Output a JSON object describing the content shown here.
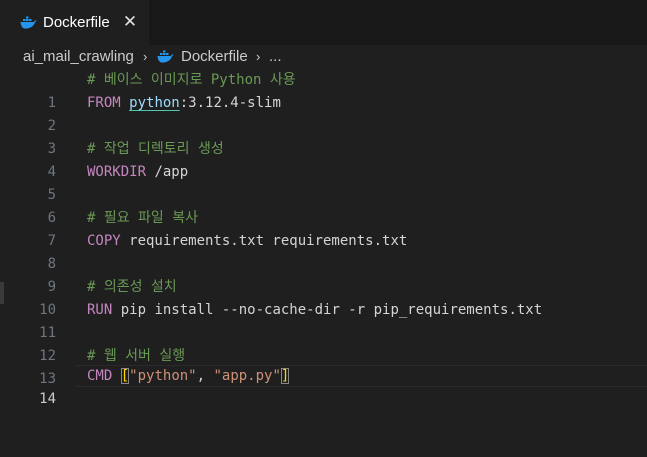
{
  "tab": {
    "label": "Dockerfile",
    "close_glyph": "✕",
    "icon": "docker-whale-icon"
  },
  "breadcrumb": {
    "folder": "ai_mail_crawling",
    "sep": "›",
    "file": "Dockerfile",
    "more": "..."
  },
  "colors": {
    "background": "#1f1f1f",
    "tabbar": "#181818",
    "comment": "#6a9955",
    "keyword": "#c586c0",
    "string": "#ce9178",
    "identifier": "#9cdcfe",
    "docker_blue": "#2496ed"
  },
  "editor": {
    "active_line": "14",
    "lines": [
      {
        "n": "1",
        "comment": "# 베이스 이미지로 Python 사용"
      },
      {
        "n": "2",
        "kw": "FROM",
        "image": "python",
        "rest": ":3.12.4-slim"
      },
      {
        "n": "3"
      },
      {
        "n": "4",
        "comment": "# 작업 디렉토리 생성"
      },
      {
        "n": "5",
        "kw": "WORKDIR",
        "rest": " /app"
      },
      {
        "n": "6"
      },
      {
        "n": "7",
        "comment": "# 필요 파일 복사"
      },
      {
        "n": "8",
        "kw": "COPY",
        "rest": " requirements.txt requirements.txt"
      },
      {
        "n": "9"
      },
      {
        "n": "10",
        "comment": "# 의존성 설치"
      },
      {
        "n": "11",
        "kw": "RUN",
        "rest": " pip install --no-cache-dir -r pip_requirements.txt"
      },
      {
        "n": "12"
      },
      {
        "n": "13",
        "comment": "# 웹 서버 실행"
      },
      {
        "n": "14",
        "kw": "CMD",
        "space": " ",
        "open": "[",
        "s1": "\"python\"",
        "comma": ", ",
        "s2": "\"app.py\"",
        "close": "]"
      }
    ]
  }
}
